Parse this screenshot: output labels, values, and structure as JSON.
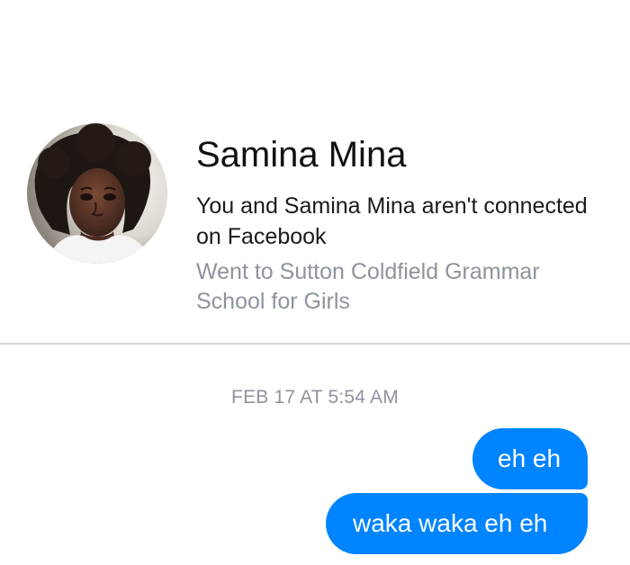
{
  "profile": {
    "name": "Samina Mina",
    "connection_status": "You and Samina Mina aren't connected on Facebook",
    "education": "Went to Sutton Coldfield Grammar School for Girls"
  },
  "conversation": {
    "timestamp": "FEB 17 AT 5:54 AM",
    "messages": [
      {
        "text": "eh eh"
      },
      {
        "text": "waka waka eh eh"
      }
    ]
  },
  "colors": {
    "outgoing_bubble": "#0084ff",
    "muted_text": "#8d949e",
    "divider": "#d5d7db"
  }
}
